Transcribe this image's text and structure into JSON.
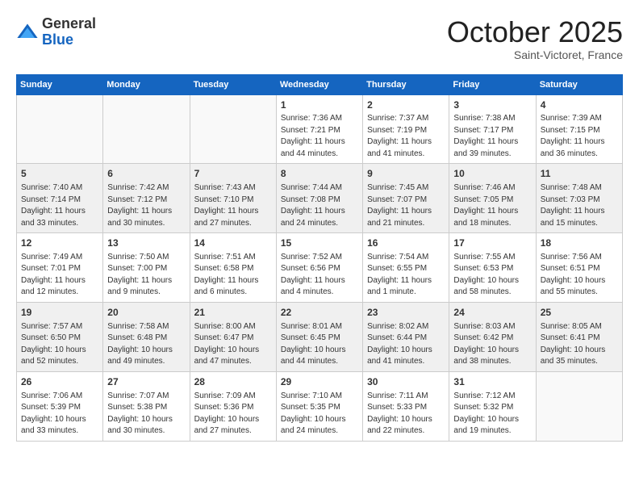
{
  "header": {
    "logo_general": "General",
    "logo_blue": "Blue",
    "month": "October 2025",
    "location": "Saint-Victoret, France"
  },
  "days_of_week": [
    "Sunday",
    "Monday",
    "Tuesday",
    "Wednesday",
    "Thursday",
    "Friday",
    "Saturday"
  ],
  "weeks": [
    {
      "shaded": false,
      "days": [
        {
          "num": "",
          "sunrise": "",
          "sunset": "",
          "daylight": ""
        },
        {
          "num": "",
          "sunrise": "",
          "sunset": "",
          "daylight": ""
        },
        {
          "num": "",
          "sunrise": "",
          "sunset": "",
          "daylight": ""
        },
        {
          "num": "1",
          "sunrise": "Sunrise: 7:36 AM",
          "sunset": "Sunset: 7:21 PM",
          "daylight": "Daylight: 11 hours and 44 minutes."
        },
        {
          "num": "2",
          "sunrise": "Sunrise: 7:37 AM",
          "sunset": "Sunset: 7:19 PM",
          "daylight": "Daylight: 11 hours and 41 minutes."
        },
        {
          "num": "3",
          "sunrise": "Sunrise: 7:38 AM",
          "sunset": "Sunset: 7:17 PM",
          "daylight": "Daylight: 11 hours and 39 minutes."
        },
        {
          "num": "4",
          "sunrise": "Sunrise: 7:39 AM",
          "sunset": "Sunset: 7:15 PM",
          "daylight": "Daylight: 11 hours and 36 minutes."
        }
      ]
    },
    {
      "shaded": true,
      "days": [
        {
          "num": "5",
          "sunrise": "Sunrise: 7:40 AM",
          "sunset": "Sunset: 7:14 PM",
          "daylight": "Daylight: 11 hours and 33 minutes."
        },
        {
          "num": "6",
          "sunrise": "Sunrise: 7:42 AM",
          "sunset": "Sunset: 7:12 PM",
          "daylight": "Daylight: 11 hours and 30 minutes."
        },
        {
          "num": "7",
          "sunrise": "Sunrise: 7:43 AM",
          "sunset": "Sunset: 7:10 PM",
          "daylight": "Daylight: 11 hours and 27 minutes."
        },
        {
          "num": "8",
          "sunrise": "Sunrise: 7:44 AM",
          "sunset": "Sunset: 7:08 PM",
          "daylight": "Daylight: 11 hours and 24 minutes."
        },
        {
          "num": "9",
          "sunrise": "Sunrise: 7:45 AM",
          "sunset": "Sunset: 7:07 PM",
          "daylight": "Daylight: 11 hours and 21 minutes."
        },
        {
          "num": "10",
          "sunrise": "Sunrise: 7:46 AM",
          "sunset": "Sunset: 7:05 PM",
          "daylight": "Daylight: 11 hours and 18 minutes."
        },
        {
          "num": "11",
          "sunrise": "Sunrise: 7:48 AM",
          "sunset": "Sunset: 7:03 PM",
          "daylight": "Daylight: 11 hours and 15 minutes."
        }
      ]
    },
    {
      "shaded": false,
      "days": [
        {
          "num": "12",
          "sunrise": "Sunrise: 7:49 AM",
          "sunset": "Sunset: 7:01 PM",
          "daylight": "Daylight: 11 hours and 12 minutes."
        },
        {
          "num": "13",
          "sunrise": "Sunrise: 7:50 AM",
          "sunset": "Sunset: 7:00 PM",
          "daylight": "Daylight: 11 hours and 9 minutes."
        },
        {
          "num": "14",
          "sunrise": "Sunrise: 7:51 AM",
          "sunset": "Sunset: 6:58 PM",
          "daylight": "Daylight: 11 hours and 6 minutes."
        },
        {
          "num": "15",
          "sunrise": "Sunrise: 7:52 AM",
          "sunset": "Sunset: 6:56 PM",
          "daylight": "Daylight: 11 hours and 4 minutes."
        },
        {
          "num": "16",
          "sunrise": "Sunrise: 7:54 AM",
          "sunset": "Sunset: 6:55 PM",
          "daylight": "Daylight: 11 hours and 1 minute."
        },
        {
          "num": "17",
          "sunrise": "Sunrise: 7:55 AM",
          "sunset": "Sunset: 6:53 PM",
          "daylight": "Daylight: 10 hours and 58 minutes."
        },
        {
          "num": "18",
          "sunrise": "Sunrise: 7:56 AM",
          "sunset": "Sunset: 6:51 PM",
          "daylight": "Daylight: 10 hours and 55 minutes."
        }
      ]
    },
    {
      "shaded": true,
      "days": [
        {
          "num": "19",
          "sunrise": "Sunrise: 7:57 AM",
          "sunset": "Sunset: 6:50 PM",
          "daylight": "Daylight: 10 hours and 52 minutes."
        },
        {
          "num": "20",
          "sunrise": "Sunrise: 7:58 AM",
          "sunset": "Sunset: 6:48 PM",
          "daylight": "Daylight: 10 hours and 49 minutes."
        },
        {
          "num": "21",
          "sunrise": "Sunrise: 8:00 AM",
          "sunset": "Sunset: 6:47 PM",
          "daylight": "Daylight: 10 hours and 47 minutes."
        },
        {
          "num": "22",
          "sunrise": "Sunrise: 8:01 AM",
          "sunset": "Sunset: 6:45 PM",
          "daylight": "Daylight: 10 hours and 44 minutes."
        },
        {
          "num": "23",
          "sunrise": "Sunrise: 8:02 AM",
          "sunset": "Sunset: 6:44 PM",
          "daylight": "Daylight: 10 hours and 41 minutes."
        },
        {
          "num": "24",
          "sunrise": "Sunrise: 8:03 AM",
          "sunset": "Sunset: 6:42 PM",
          "daylight": "Daylight: 10 hours and 38 minutes."
        },
        {
          "num": "25",
          "sunrise": "Sunrise: 8:05 AM",
          "sunset": "Sunset: 6:41 PM",
          "daylight": "Daylight: 10 hours and 35 minutes."
        }
      ]
    },
    {
      "shaded": false,
      "days": [
        {
          "num": "26",
          "sunrise": "Sunrise: 7:06 AM",
          "sunset": "Sunset: 5:39 PM",
          "daylight": "Daylight: 10 hours and 33 minutes."
        },
        {
          "num": "27",
          "sunrise": "Sunrise: 7:07 AM",
          "sunset": "Sunset: 5:38 PM",
          "daylight": "Daylight: 10 hours and 30 minutes."
        },
        {
          "num": "28",
          "sunrise": "Sunrise: 7:09 AM",
          "sunset": "Sunset: 5:36 PM",
          "daylight": "Daylight: 10 hours and 27 minutes."
        },
        {
          "num": "29",
          "sunrise": "Sunrise: 7:10 AM",
          "sunset": "Sunset: 5:35 PM",
          "daylight": "Daylight: 10 hours and 24 minutes."
        },
        {
          "num": "30",
          "sunrise": "Sunrise: 7:11 AM",
          "sunset": "Sunset: 5:33 PM",
          "daylight": "Daylight: 10 hours and 22 minutes."
        },
        {
          "num": "31",
          "sunrise": "Sunrise: 7:12 AM",
          "sunset": "Sunset: 5:32 PM",
          "daylight": "Daylight: 10 hours and 19 minutes."
        },
        {
          "num": "",
          "sunrise": "",
          "sunset": "",
          "daylight": ""
        }
      ]
    }
  ]
}
